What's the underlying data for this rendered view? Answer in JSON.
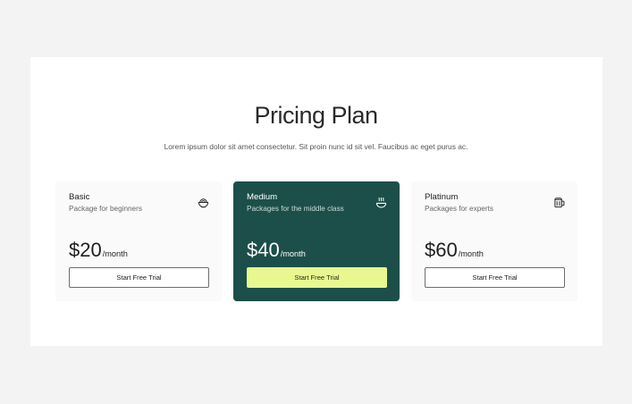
{
  "header": {
    "title": "Pricing Plan",
    "subtitle": "Lorem ipsum dolor sit amet consectetur. Sit proin nunc id sit vel. Faucibus ac eget purus ac."
  },
  "plans": [
    {
      "name": "Basic",
      "description": "Package for beginners",
      "price": "$20",
      "period": "/month",
      "cta": "Start Free Trial",
      "icon": "bowl-icon"
    },
    {
      "name": "Medium",
      "description": "Packages for the middle class",
      "price": "$40",
      "period": "/month",
      "cta": "Start Free Trial",
      "icon": "hot-bowl-icon"
    },
    {
      "name": "Platinum",
      "description": "Packages for experts",
      "price": "$60",
      "period": "/month",
      "cta": "Start Free Trial",
      "icon": "mug-icon"
    }
  ],
  "colors": {
    "background": "#f3f3f3",
    "panel": "#ffffff",
    "featured_card": "#1c4f49",
    "featured_button": "#e8f78f",
    "card": "#fafafa"
  }
}
